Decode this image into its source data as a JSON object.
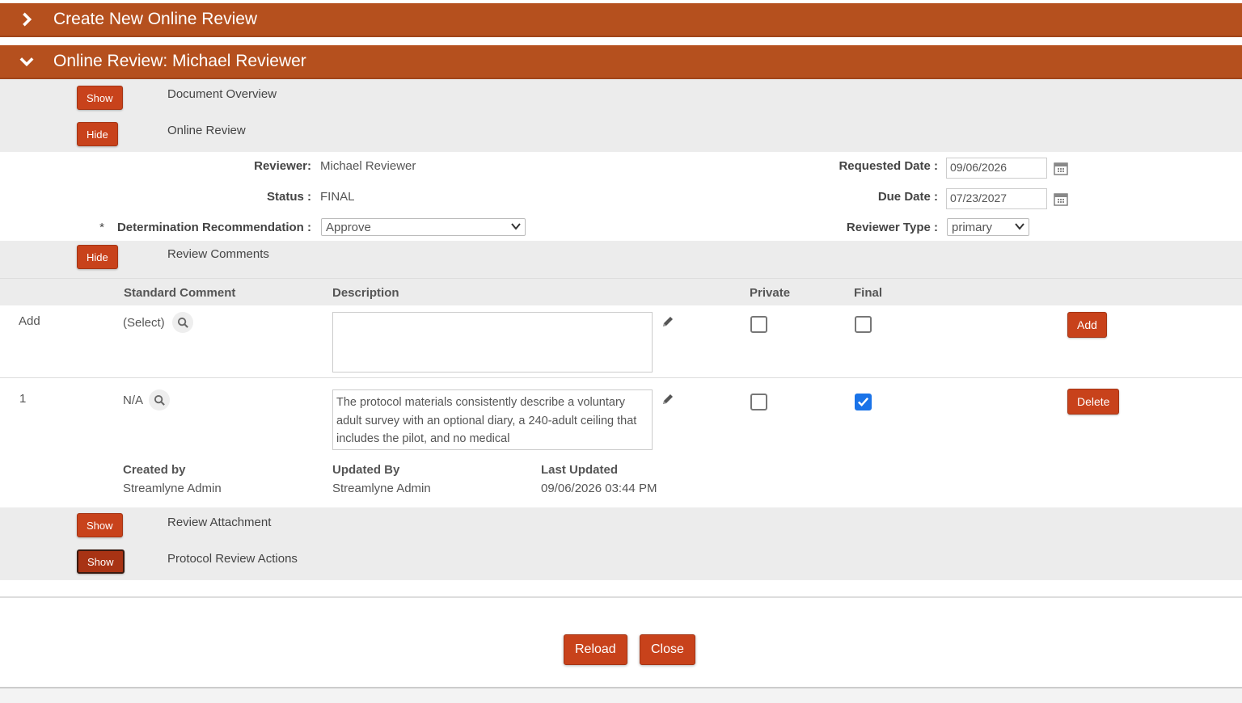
{
  "header_create": {
    "title": "Create New Online Review"
  },
  "header_review": {
    "title": "Online Review: Michael Reviewer"
  },
  "sections": {
    "document_overview": {
      "button": "Show",
      "label": "Document Overview"
    },
    "online_review": {
      "button": "Hide",
      "label": "Online Review"
    },
    "review_comments": {
      "button": "Hide",
      "label": "Review Comments"
    },
    "review_attachment": {
      "button": "Show",
      "label": "Review Attachment"
    },
    "protocol_review_actions": {
      "button": "Show",
      "label": "Protocol Review Actions"
    }
  },
  "review": {
    "reviewer_label": "Reviewer:",
    "reviewer_value": "Michael Reviewer",
    "status_label": "Status :",
    "status_value": "FINAL",
    "required_marker": "*",
    "determination_label": "Determination Recommendation :",
    "determination_value": "Approve",
    "requested_date_label": "Requested Date :",
    "requested_date_value": "09/06/2026",
    "due_date_label": "Due Date :",
    "due_date_value": "07/23/2027",
    "reviewer_type_label": "Reviewer Type :",
    "reviewer_type_value": "primary"
  },
  "comments_table": {
    "headers": {
      "standard_comment": "Standard Comment",
      "description": "Description",
      "private": "Private",
      "final": "Final"
    },
    "add_row": {
      "label": "Add",
      "standard_comment": "(Select)",
      "description": "",
      "private": false,
      "final": false,
      "button": "Add"
    },
    "rows": [
      {
        "index": "1",
        "standard_comment": "N/A",
        "description": "The protocol materials consistently describe a voluntary adult survey with an optional diary, a 240-adult ceiling that includes the pilot, and no medical",
        "private": false,
        "final": true,
        "button": "Delete",
        "created_by_label": "Created by",
        "created_by": "Streamlyne Admin",
        "updated_by_label": "Updated By",
        "updated_by": "Streamlyne Admin",
        "last_updated_label": "Last Updated",
        "last_updated": "09/06/2026 03:44 PM"
      }
    ]
  },
  "footer": {
    "reload": "Reload",
    "close": "Close"
  },
  "colors": {
    "brand": "#b5501e",
    "button": "#c8421b",
    "check": "#1a73e8"
  },
  "icons": [
    "chevron-right-icon",
    "chevron-down-icon",
    "calendar-icon",
    "search-icon",
    "pencil-icon",
    "checkmark-icon"
  ]
}
